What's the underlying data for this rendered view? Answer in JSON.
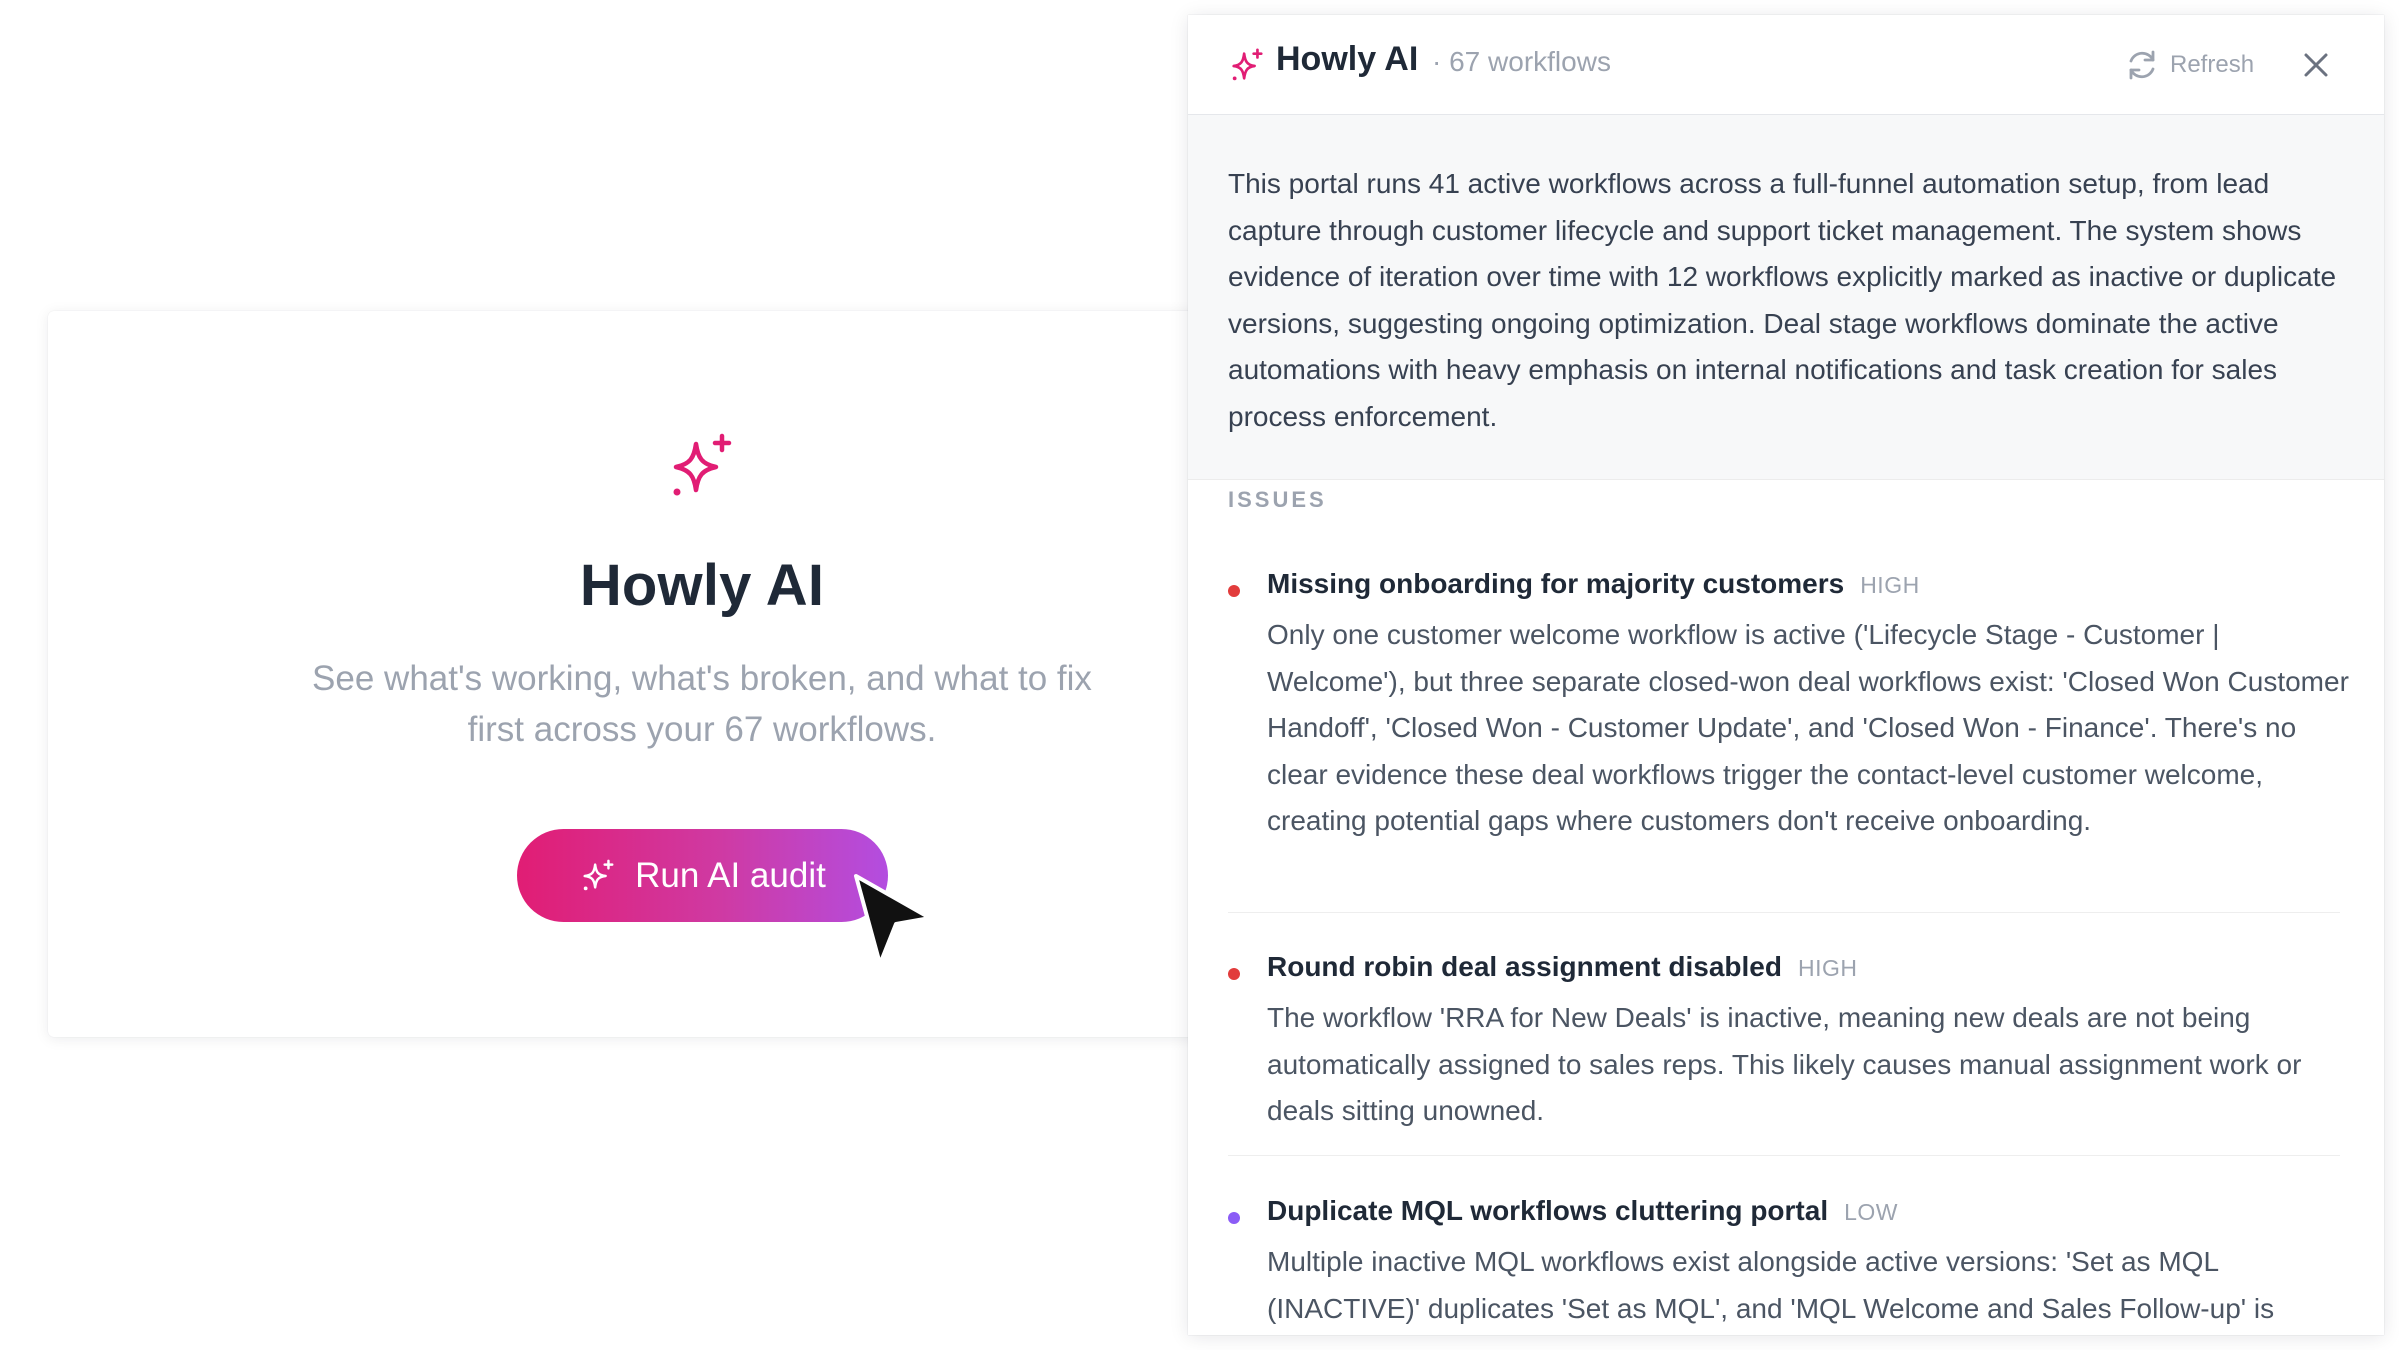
{
  "intro": {
    "title": "Howly AI",
    "subtitle": "See what's working, what's broken, and what to fix first across your 67 workflows.",
    "run_button_label": "Run AI audit"
  },
  "panel": {
    "title": "Howly AI",
    "count": "· 67 workflows",
    "refresh_label": "Refresh",
    "summary": "This portal runs 41 active workflows across a full-funnel automation setup, from lead capture through customer lifecycle and support ticket management. The system shows evidence of iteration over time with 12 workflows explicitly marked as inactive or duplicate versions, suggesting ongoing optimization. Deal stage workflows dominate the active automations with heavy emphasis on internal notifications and task creation for sales process enforcement.",
    "issues_label": "ISSUES",
    "issues": [
      {
        "title": "Missing onboarding for majority customers",
        "severity": "HIGH",
        "color": "#e23c3c",
        "description": "Only one customer welcome workflow is active ('Lifecycle Stage - Customer | Welcome'), but three separate closed-won deal workflows exist: 'Closed Won Customer Handoff', 'Closed Won - Customer Update', and 'Closed Won - Finance'. There's no clear evidence these deal workflows trigger the contact-level customer welcome, creating potential gaps where customers don't receive onboarding."
      },
      {
        "title": "Round robin deal assignment disabled",
        "severity": "HIGH",
        "color": "#e23c3c",
        "description": "The workflow 'RRA for New Deals' is inactive, meaning new deals are not being automatically assigned to sales reps. This likely causes manual assignment work or deals sitting unowned."
      },
      {
        "title": "Duplicate MQL workflows cluttering portal",
        "severity": "LOW",
        "color": "#8b5cf6",
        "description": "Multiple inactive MQL workflows exist alongside active versions: 'Set as MQL (INACTIVE)' duplicates 'Set as MQL', and 'MQL Welcome and Sales Follow-up' is"
      }
    ]
  },
  "colors": {
    "accent": "#e11d74",
    "gradient_end": "#b34de0"
  }
}
